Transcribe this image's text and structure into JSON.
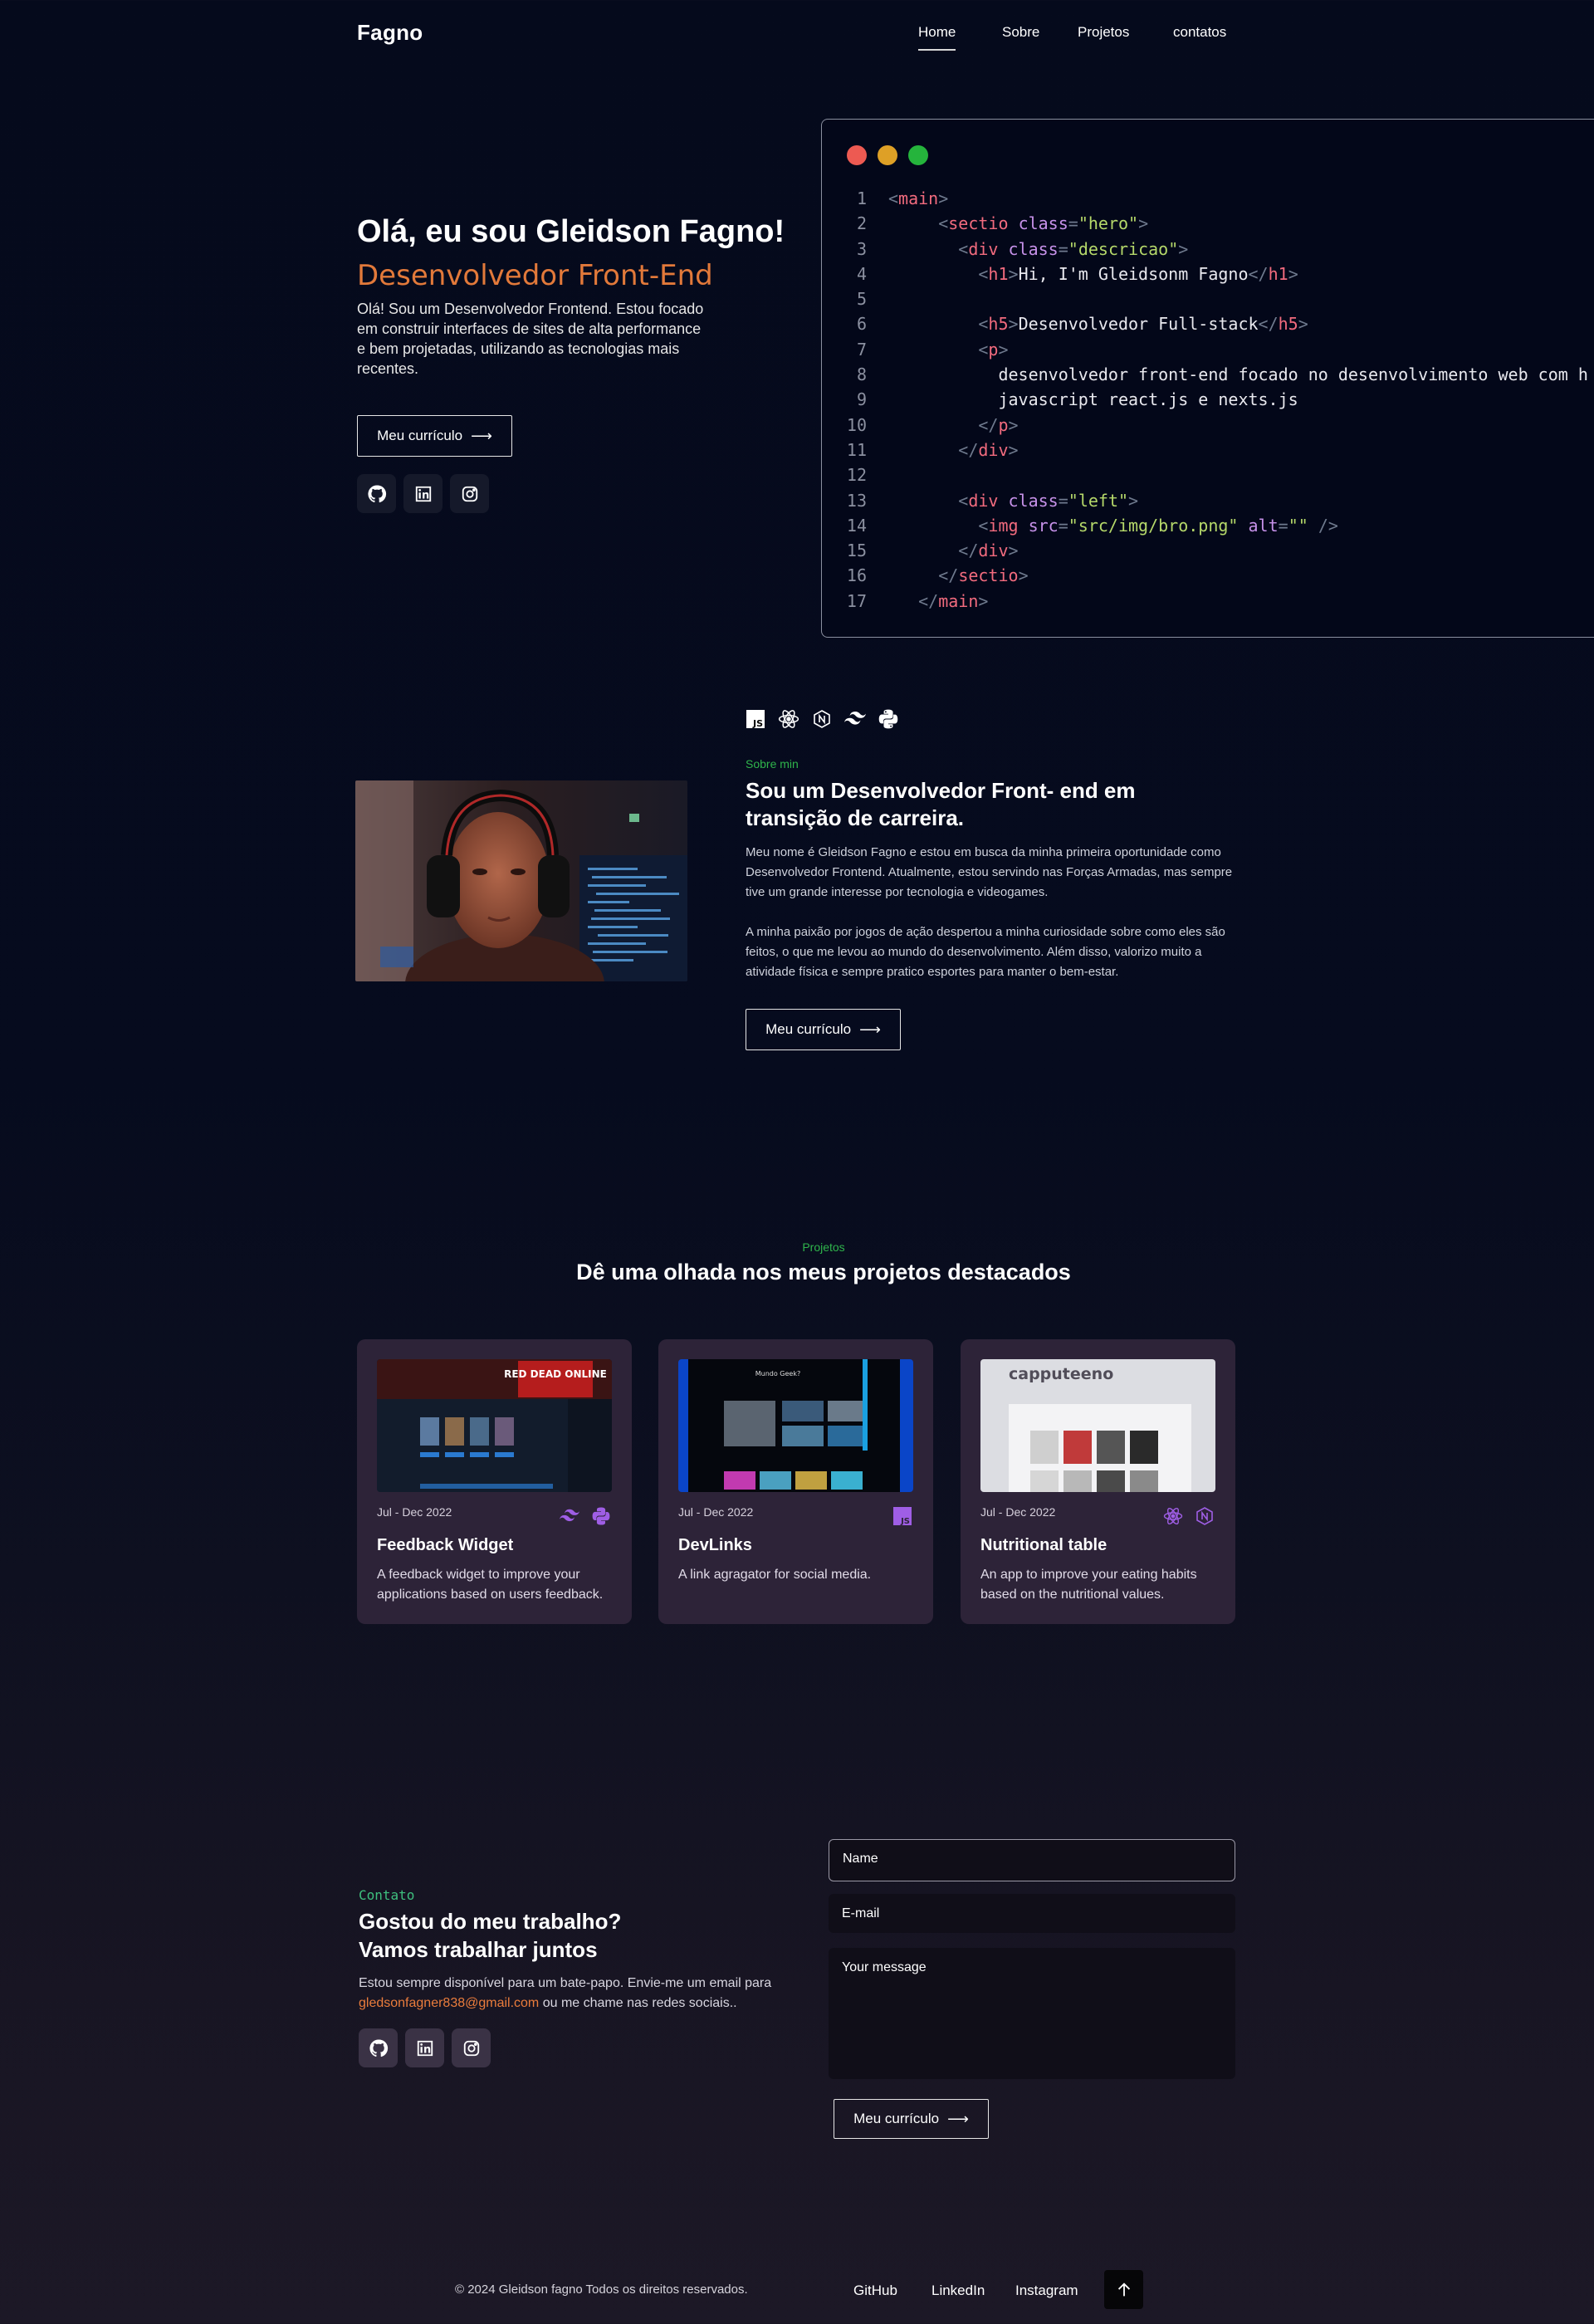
{
  "header": {
    "logo": "Fagno",
    "nav": [
      {
        "label": "Home",
        "active": true
      },
      {
        "label": "Sobre",
        "active": false
      },
      {
        "label": "Projetos",
        "active": false
      },
      {
        "label": "contatos",
        "active": false
      }
    ]
  },
  "hero": {
    "title": "Olá, eu sou Gleidson Fagno!",
    "subtitle": "Desenvolvedor Front-End",
    "description": "Olá! Sou um Desenvolvedor Frontend. Estou focado em construir interfaces de sites de alta performance e bem projetadas, utilizando as tecnologias mais recentes.",
    "button_label": "Meu currículo",
    "socials": [
      "github-icon",
      "linkedin-icon",
      "instagram-icon"
    ]
  },
  "code_window": {
    "dot_colors": [
      "#ed5a52",
      "#dea026",
      "#25b43c"
    ],
    "lines": [
      {
        "n": "1",
        "indent": "",
        "tokens": [
          [
            "br",
            "<"
          ],
          [
            "tag",
            "main"
          ],
          [
            "br",
            ">"
          ]
        ]
      },
      {
        "n": "2",
        "indent": "     ",
        "tokens": [
          [
            "br",
            "<"
          ],
          [
            "tag",
            "sectio"
          ],
          [
            "txt",
            " "
          ],
          [
            "attr",
            "class"
          ],
          [
            "br",
            "="
          ],
          [
            "str",
            "\"hero\""
          ],
          [
            "br",
            ">"
          ]
        ]
      },
      {
        "n": "3",
        "indent": "       ",
        "tokens": [
          [
            "br",
            "<"
          ],
          [
            "tag",
            "div"
          ],
          [
            "txt",
            " "
          ],
          [
            "attr",
            "class"
          ],
          [
            "br",
            "="
          ],
          [
            "str",
            "\"descricao\""
          ],
          [
            "br",
            ">"
          ]
        ]
      },
      {
        "n": "4",
        "indent": "         ",
        "tokens": [
          [
            "br",
            "<"
          ],
          [
            "tag",
            "h1"
          ],
          [
            "br",
            ">"
          ],
          [
            "txt",
            "Hi, I'm Gleidsonm Fagno"
          ],
          [
            "br",
            "</"
          ],
          [
            "tag",
            "h1"
          ],
          [
            "br",
            ">"
          ]
        ]
      },
      {
        "n": "5",
        "indent": "",
        "tokens": []
      },
      {
        "n": "6",
        "indent": "         ",
        "tokens": [
          [
            "br",
            "<"
          ],
          [
            "tag",
            "h5"
          ],
          [
            "br",
            ">"
          ],
          [
            "txt",
            "Desenvolvedor Full-stack"
          ],
          [
            "br",
            "</"
          ],
          [
            "tag",
            "h5"
          ],
          [
            "br",
            ">"
          ]
        ]
      },
      {
        "n": "7",
        "indent": "         ",
        "tokens": [
          [
            "br",
            "<"
          ],
          [
            "tag",
            "p"
          ],
          [
            "br",
            ">"
          ]
        ]
      },
      {
        "n": "8",
        "indent": "           ",
        "tokens": [
          [
            "txt",
            "desenvolvedor front-end focado no desenvolvimento web com h"
          ]
        ]
      },
      {
        "n": "9",
        "indent": "           ",
        "tokens": [
          [
            "txt",
            "javascript react.js e nexts.js"
          ]
        ]
      },
      {
        "n": "10",
        "indent": "         ",
        "tokens": [
          [
            "br",
            "</"
          ],
          [
            "tag",
            "p"
          ],
          [
            "br",
            ">"
          ]
        ]
      },
      {
        "n": "11",
        "indent": "       ",
        "tokens": [
          [
            "br",
            "</"
          ],
          [
            "tag",
            "div"
          ],
          [
            "br",
            ">"
          ]
        ]
      },
      {
        "n": "12",
        "indent": "",
        "tokens": []
      },
      {
        "n": "13",
        "indent": "       ",
        "tokens": [
          [
            "br",
            "<"
          ],
          [
            "tag",
            "div"
          ],
          [
            "txt",
            " "
          ],
          [
            "attr",
            "class"
          ],
          [
            "br",
            "="
          ],
          [
            "str",
            "\"left\""
          ],
          [
            "br",
            ">"
          ]
        ]
      },
      {
        "n": "14",
        "indent": "         ",
        "tokens": [
          [
            "br",
            "<"
          ],
          [
            "tag",
            "img"
          ],
          [
            "txt",
            " "
          ],
          [
            "attr",
            "src"
          ],
          [
            "br",
            "="
          ],
          [
            "str",
            "\"src/img/bro.png\""
          ],
          [
            "txt",
            " "
          ],
          [
            "attr",
            "alt"
          ],
          [
            "br",
            "="
          ],
          [
            "str",
            "\"\""
          ],
          [
            "txt",
            " "
          ],
          [
            "br",
            "/>"
          ]
        ]
      },
      {
        "n": "15",
        "indent": "       ",
        "tokens": [
          [
            "br",
            "</"
          ],
          [
            "tag",
            "div"
          ],
          [
            "br",
            ">"
          ]
        ]
      },
      {
        "n": "16",
        "indent": "     ",
        "tokens": [
          [
            "br",
            "</"
          ],
          [
            "tag",
            "sectio"
          ],
          [
            "br",
            ">"
          ]
        ]
      },
      {
        "n": "17",
        "indent": "   ",
        "tokens": [
          [
            "br",
            "</"
          ],
          [
            "tag",
            "main"
          ],
          [
            "br",
            ">"
          ]
        ]
      }
    ]
  },
  "about": {
    "tech_icons": [
      "javascript-icon",
      "react-icon",
      "nextjs-icon",
      "tailwind-icon",
      "python-icon"
    ],
    "label": "Sobre min",
    "title": "Sou um Desenvolvedor Front- end em transição de carreira.",
    "p1": "Meu nome é Gleidson Fagno e estou em busca da minha primeira oportunidade como Desenvolvedor Frontend. Atualmente, estou servindo nas Forças Armadas, mas sempre tive um grande interesse por tecnologia e videogames.",
    "p2": "A minha paixão por jogos de ação despertou a minha curiosidade sobre como eles são feitos, o que me levou ao mundo do desenvolvimento. Além disso, valorizo muito a atividade física e sempre pratico esportes para manter o bem-estar.",
    "button_label": "Meu currículo"
  },
  "projects": {
    "label": "Projetos",
    "title": "Dê uma olhada nos meus projetos destacados",
    "items": [
      {
        "date": "Jul - Dec 2022",
        "title": "Feedback Widget",
        "description": "A feedback widget to improve your applications based on users feedback.",
        "icons": [
          "tailwind-icon",
          "python-icon"
        ],
        "thumb_text": "RED DEAD ONLINE"
      },
      {
        "date": "Jul - Dec 2022",
        "title": "DevLinks",
        "description": "A link agragator for social media.",
        "icons": [
          "javascript-icon"
        ],
        "thumb_text": "Mundo Geek?"
      },
      {
        "date": "Jul - Dec 2022",
        "title": "Nutritional table",
        "description": "An app to improve your eating habits based on the nutritional values.",
        "icons": [
          "react-icon",
          "nextjs-icon"
        ],
        "thumb_text": "capputeeno"
      }
    ]
  },
  "contact": {
    "label": "Contato",
    "title_line1": "Gostou do meu trabalho?",
    "title_line2": "Vamos trabalhar juntos",
    "text_before": "Estou sempre disponível para um bate-papo. Envie-me um email para ",
    "email": "gledsonfagner838@gmail.com",
    "text_after": " ou me chame nas redes sociais..",
    "socials": [
      "github-icon",
      "linkedin-icon",
      "instagram-icon"
    ],
    "form": {
      "name_placeholder": "Name",
      "email_placeholder": "E-mail",
      "message_placeholder": "Your message",
      "button_label": "Meu currículo"
    }
  },
  "footer": {
    "copyright": "© 2024 Gleidson fagno Todos os direitos reservados.",
    "links": [
      "GitHub",
      "LinkedIn",
      "Instagram"
    ],
    "top_icon": "arrow-up-icon"
  }
}
